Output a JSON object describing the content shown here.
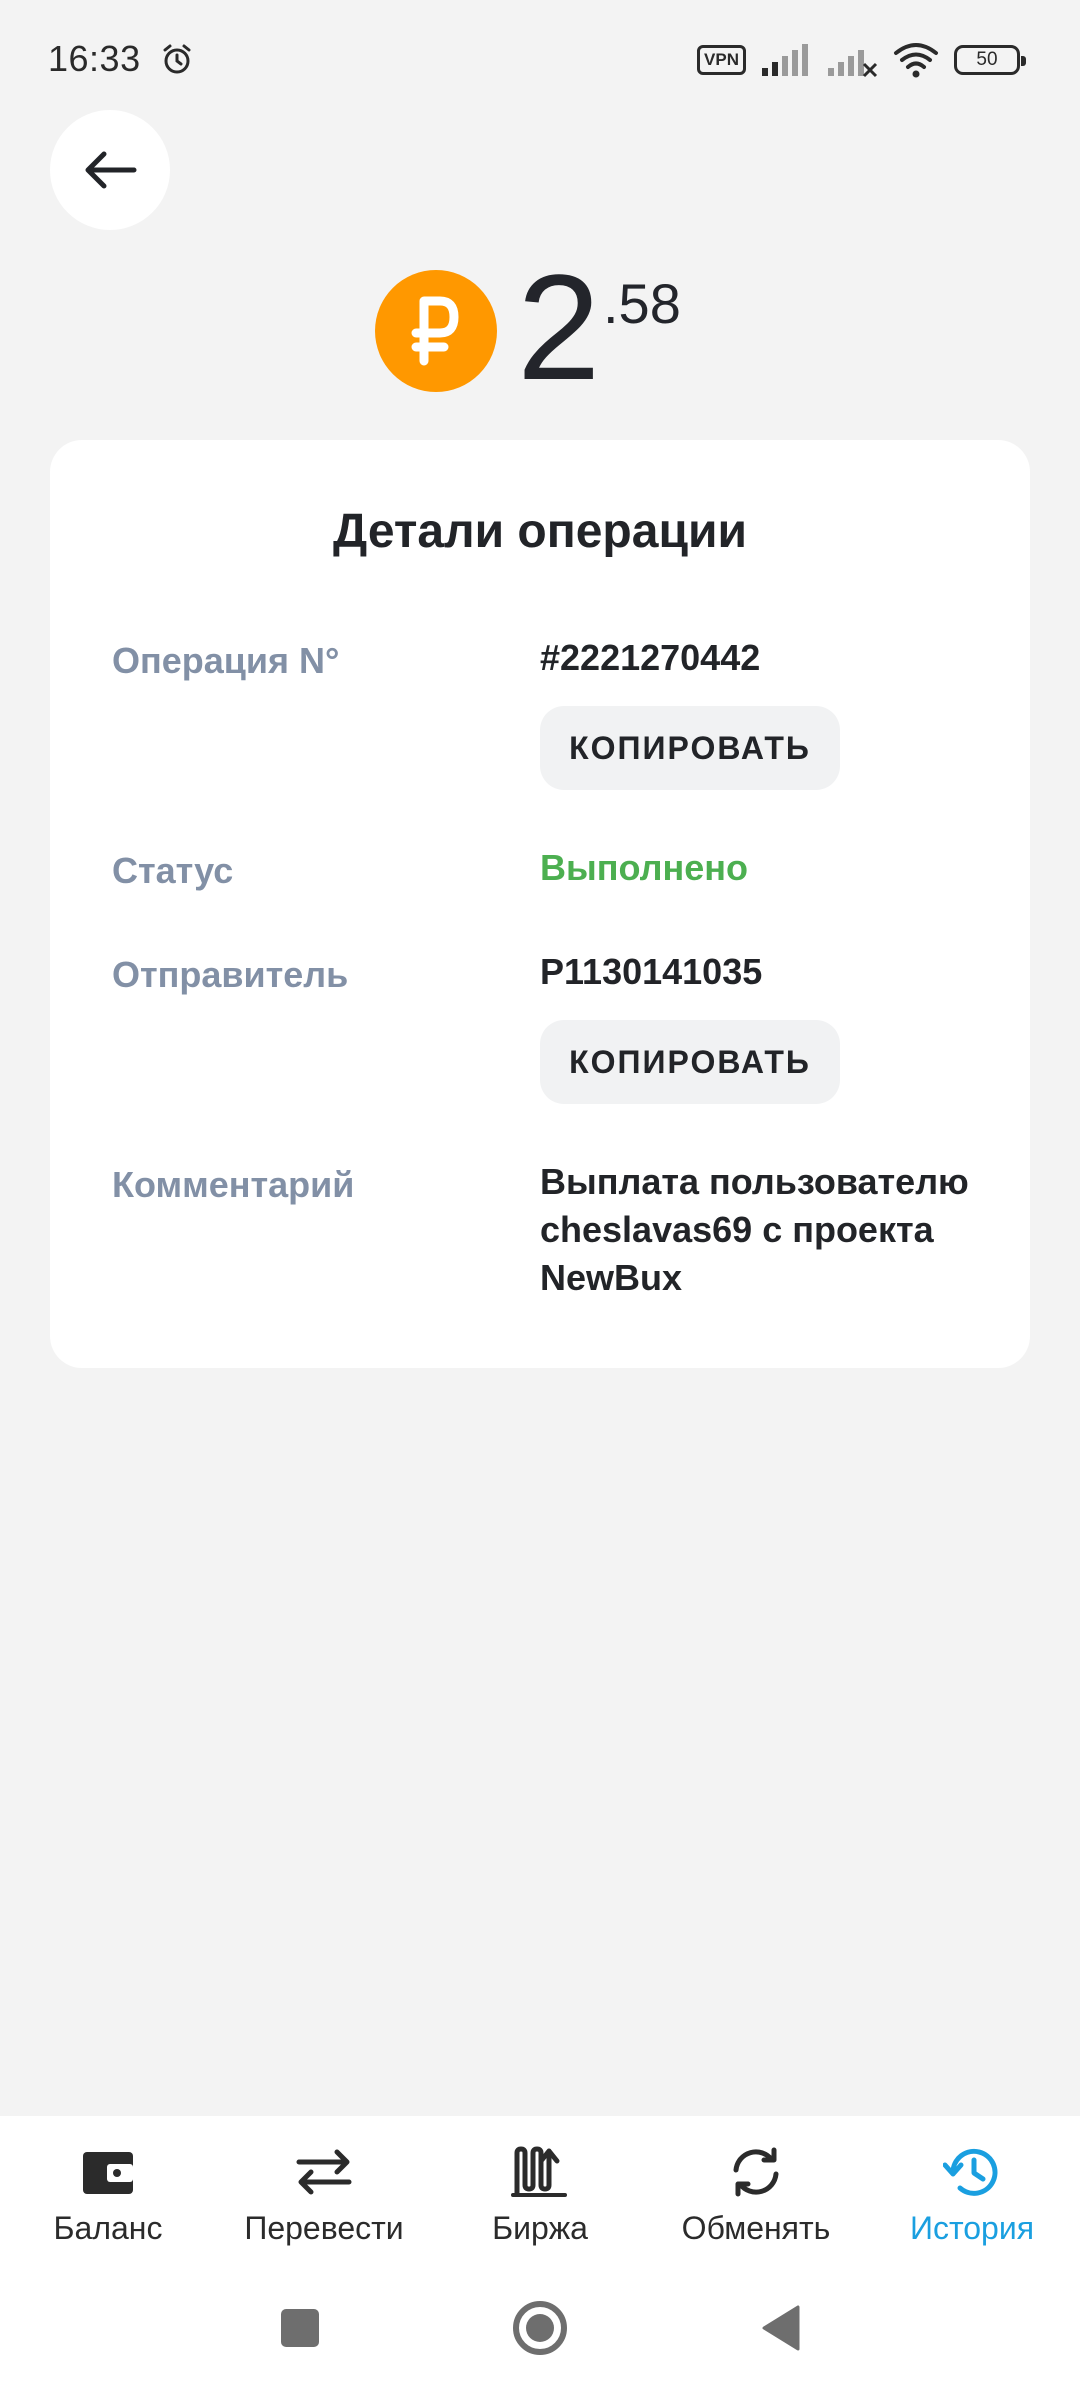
{
  "status_bar": {
    "time": "16:33",
    "vpn": "VPN",
    "battery": "50"
  },
  "amount": {
    "currency_symbol": "₽",
    "integer": "2",
    "decimal": ".58"
  },
  "card": {
    "title": "Детали операции",
    "rows": [
      {
        "label": "Операция N°",
        "value": "#2221270442",
        "copy": "КОПИРОВАТЬ"
      },
      {
        "label": "Статус",
        "value": "Выполнено"
      },
      {
        "label": "Отправитель",
        "value": "P1130141035",
        "copy": "КОПИРОВАТЬ"
      },
      {
        "label": "Комментарий",
        "value_lines": [
          "Выплата пользователю",
          "cheslavas69 с проекта",
          "NewBux"
        ]
      }
    ]
  },
  "bottom_nav": {
    "items": [
      {
        "label": "Баланс",
        "icon": "wallet-icon"
      },
      {
        "label": "Перевести",
        "icon": "transfer-arrows-icon"
      },
      {
        "label": "Биржа",
        "icon": "exchange-chart-icon"
      },
      {
        "label": "Обменять",
        "icon": "swap-cycle-icon"
      },
      {
        "label": "История",
        "icon": "history-clock-icon",
        "active": true
      }
    ]
  },
  "colors": {
    "accent": "#1a9fe0",
    "coin": "#ff9800",
    "success": "#4caf50",
    "label": "#8290a6"
  }
}
